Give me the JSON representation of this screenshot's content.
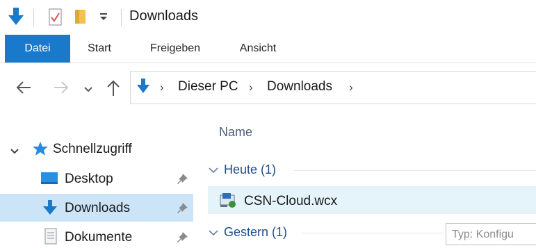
{
  "window": {
    "title": "Downloads"
  },
  "ribbon": {
    "tabs": [
      {
        "label": "Datei"
      },
      {
        "label": "Start"
      },
      {
        "label": "Freigeben"
      },
      {
        "label": "Ansicht"
      }
    ]
  },
  "address": {
    "crumbs": [
      "Dieser PC",
      "Downloads"
    ]
  },
  "navigation_pane": {
    "quick_access_label": "Schnellzugriff",
    "items": [
      {
        "label": "Desktop",
        "icon": "desktop-icon",
        "pinned": true
      },
      {
        "label": "Downloads",
        "icon": "downloads-icon",
        "pinned": true,
        "selected": true
      },
      {
        "label": "Dokumente",
        "icon": "documents-icon",
        "pinned": true
      }
    ]
  },
  "content": {
    "column_name": "Name",
    "groups": [
      {
        "label": "Heute (1)",
        "files": [
          {
            "name": "CSN-Cloud.wcx",
            "icon": "wcx-file-icon"
          }
        ]
      },
      {
        "label": "Gestern (1)",
        "files": []
      }
    ],
    "tooltip_text": "Typ: Konfigu"
  },
  "colors": {
    "accent": "#1979ca",
    "selection": "#cce4f7",
    "hover_row": "#e5f3fb",
    "group_text": "#1e4e8c"
  }
}
